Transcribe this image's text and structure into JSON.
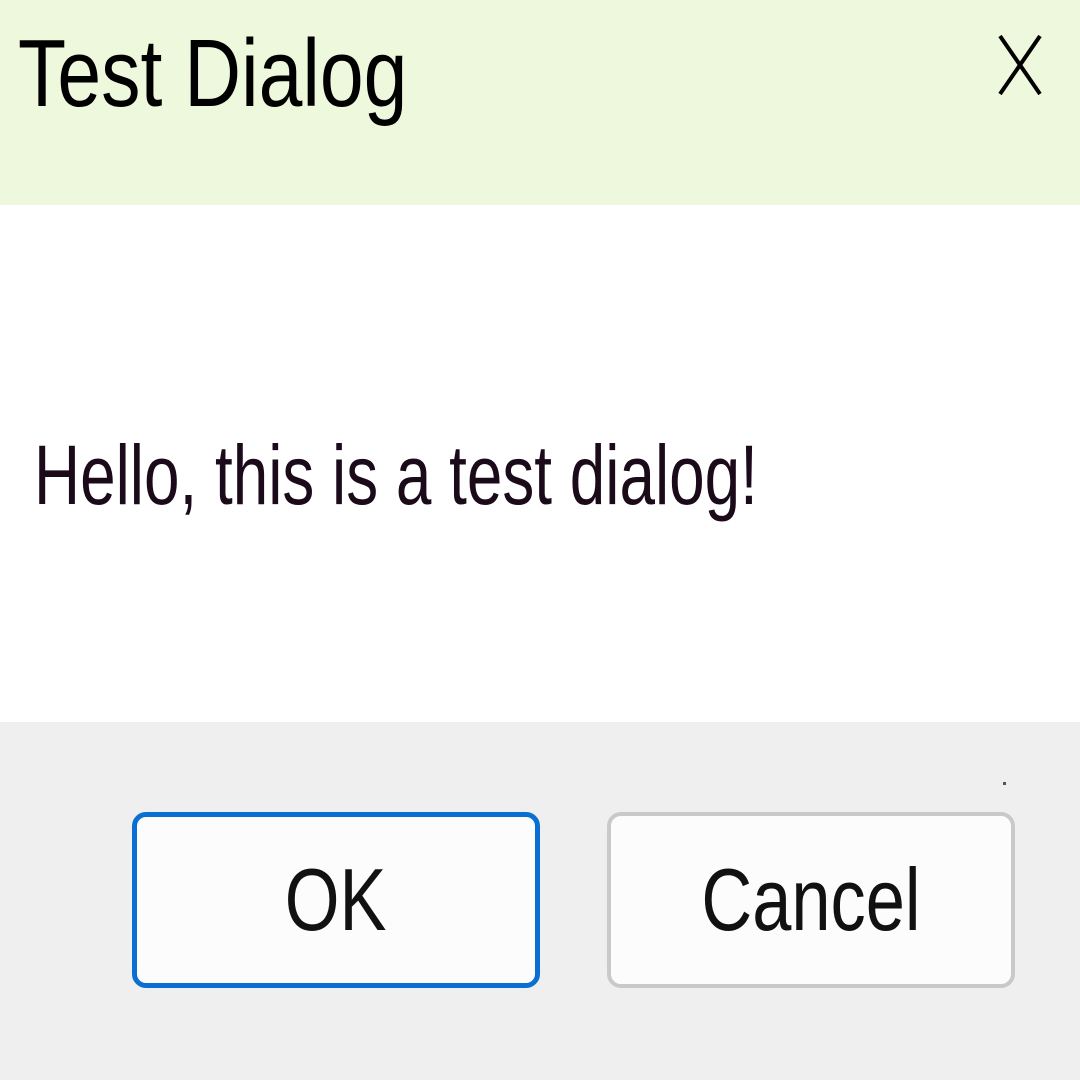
{
  "window": {
    "title": "Test Dialog",
    "close_icon": "close-icon"
  },
  "content": {
    "message": "Hello, this is a test dialog!"
  },
  "buttons": {
    "ok_label": "OK",
    "cancel_label": "Cancel"
  },
  "colors": {
    "titlebar_background": "#eef8dc",
    "footer_background": "#efefef",
    "default_button_border": "#0a6fd0",
    "button_border": "#c9c9c9"
  }
}
